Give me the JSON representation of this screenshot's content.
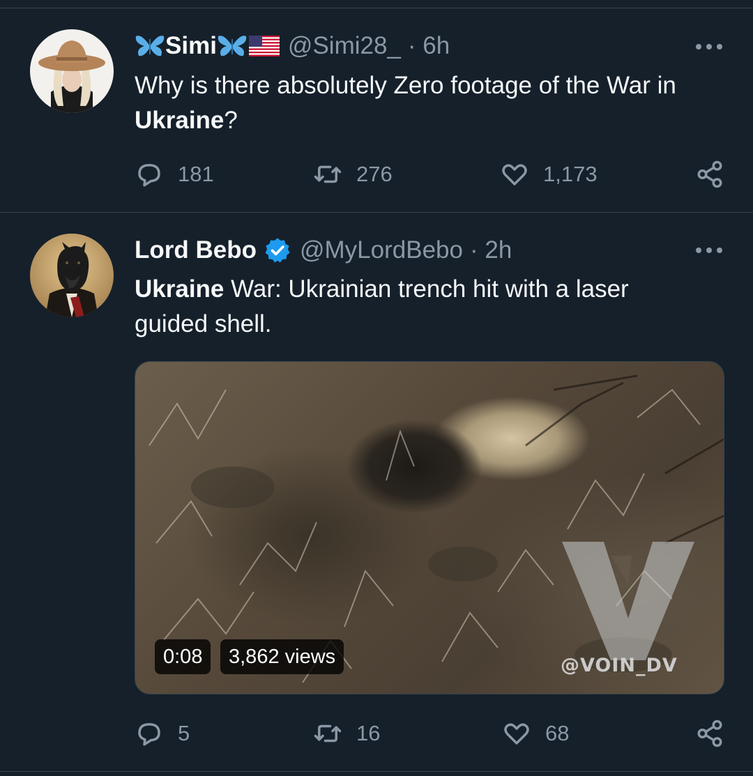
{
  "tweets": [
    {
      "display_name": "Simi",
      "handle": "@Simi28_",
      "time": "· 6h",
      "text_plain_before": "Why is there absolutely Zero footage of the War in ",
      "text_bold": "Ukraine",
      "text_plain_after": "?",
      "replies": "181",
      "retweets": "276",
      "likes": "1,173"
    },
    {
      "display_name": "Lord Bebo",
      "handle": "@MyLordBebo",
      "time": "· 2h",
      "text_bold": "Ukraine",
      "text_plain_after": " War: Ukrainian trench hit with a laser guided shell.",
      "video_duration": "0:08",
      "video_views": "3,862 views",
      "video_watermark": "@VOIN_DV",
      "replies": "5",
      "retweets": "16",
      "likes": "68"
    }
  ],
  "icons": {
    "more": "more-options-icon",
    "reply": "reply-icon",
    "retweet": "retweet-icon",
    "like": "heart-icon",
    "share": "share-icon",
    "verified": "verified-badge-icon",
    "butterfly": "butterfly-emoji",
    "flag": "us-flag-emoji"
  },
  "colors": {
    "background": "#15202b",
    "divider": "#38444d",
    "text_primary": "#f7f9f9",
    "text_secondary": "#8b98a5",
    "verified_blue": "#1d9bf0",
    "butterfly_blue": "#5aaee8"
  }
}
